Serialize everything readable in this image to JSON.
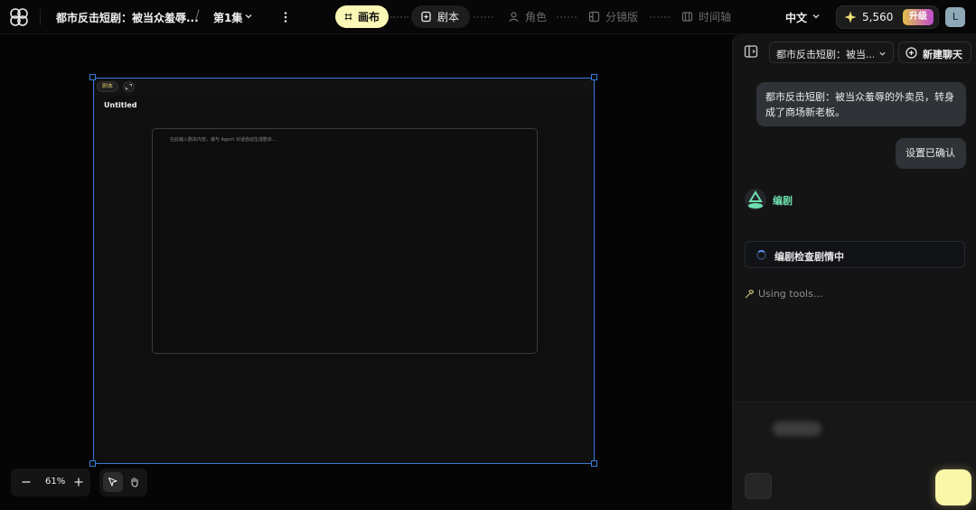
{
  "header": {
    "project_title": "都市反击短剧：被当众羞辱...",
    "separator": "/",
    "episode": "第1集",
    "steps": [
      {
        "label": "画布",
        "state": "active"
      },
      {
        "label": "剧本",
        "state": "current"
      },
      {
        "label": "角色",
        "state": "disabled"
      },
      {
        "label": "分镜版",
        "state": "disabled"
      },
      {
        "label": "时间轴",
        "state": "disabled"
      }
    ],
    "language": "中文",
    "credits": "5,560",
    "upgrade_label": "升级",
    "avatar_initial": "L"
  },
  "canvas": {
    "frame_badge": "剧本",
    "doc_title": "Untitled",
    "editor_placeholder": "在此输入剧本内容，或与 Agent 对话自动生成剧本...",
    "zoom_level": "61%"
  },
  "chat": {
    "conversation_title": "都市反击短剧：被当...",
    "new_chat_label": "新建聊天",
    "messages": [
      {
        "role": "user",
        "text": "都市反击短剧：被当众羞辱的外卖员，转身成了商场新老板。"
      },
      {
        "role": "user",
        "text": "设置已确认"
      }
    ],
    "agent_name": "编剧",
    "tool_call_label": "编剧检查剧情中",
    "status_text": "Using tools..."
  },
  "colors": {
    "accent_yellow": "#fbf7b4",
    "selection_blue": "#3a78d8",
    "agent_green": "#6fe0b0",
    "panel_bg": "#141414"
  }
}
